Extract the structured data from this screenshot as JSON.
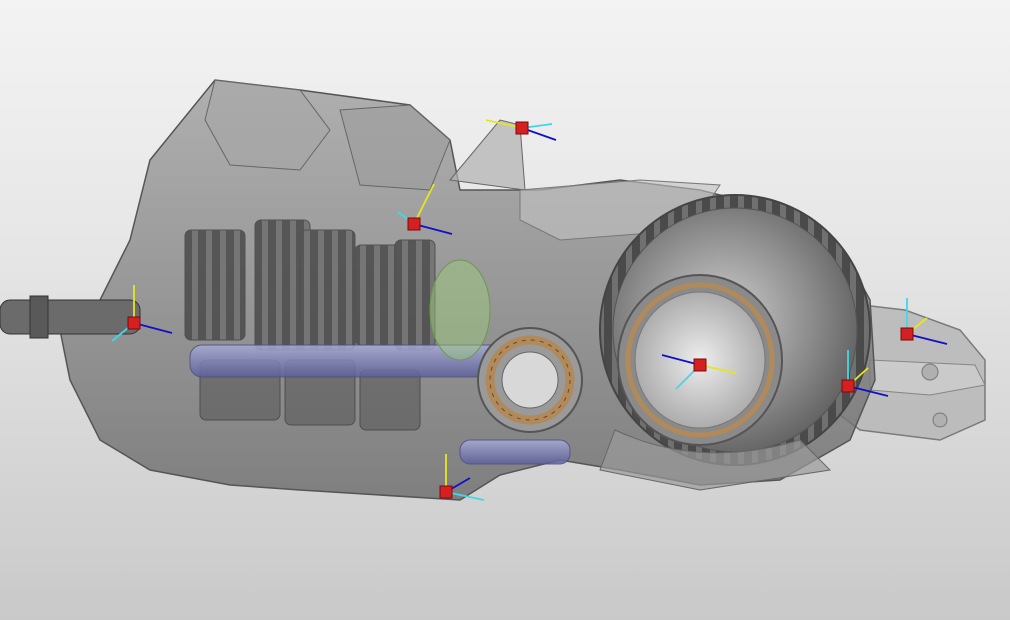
{
  "viewport": {
    "background_top": "#f3f3f3",
    "background_bottom": "#c9c9c9"
  },
  "model": {
    "description_visible_text": "",
    "part_color": "#8c8c8c",
    "edge_color": "#555555",
    "bearing_color": "#b08a5a",
    "shaft_color": "#7d82c8"
  },
  "triad_colors": {
    "origin": "#d42020",
    "x_axis": "#1010c8",
    "y_axis": "#e6e620",
    "z_axis": "#40d8e8"
  },
  "coordinate_markers": [
    {
      "name": "marker-top-mount"
    },
    {
      "name": "marker-upper-housing"
    },
    {
      "name": "marker-output-shaft"
    },
    {
      "name": "marker-ring-gear-center"
    },
    {
      "name": "marker-rear-mount-lower"
    },
    {
      "name": "marker-rear-mount-upper"
    },
    {
      "name": "marker-bottom-housing"
    }
  ]
}
